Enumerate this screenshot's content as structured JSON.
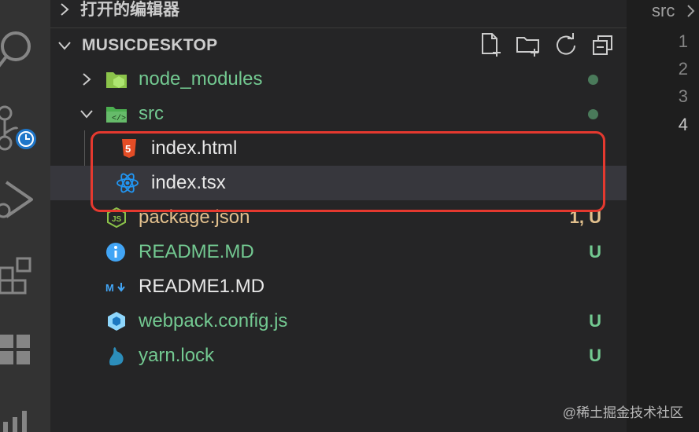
{
  "activity_bar": {
    "icons": [
      "search-icon",
      "source-control-icon",
      "clock-badge-icon",
      "run-debug-icon",
      "extensions-icon",
      "grid-icon",
      "chart-icon"
    ]
  },
  "explorer": {
    "open_editors_label": "打开的编辑器",
    "project_name": "MUSICDESKTOP",
    "toolbar_icons": [
      "new-file-icon",
      "new-folder-icon",
      "refresh-icon",
      "collapse-all-icon"
    ],
    "items": [
      {
        "name": "node_modules",
        "kind": "folder",
        "color": "#73c991",
        "decoration": "dot"
      },
      {
        "name": "src",
        "kind": "folder",
        "color": "#73c991",
        "decoration": "dot"
      },
      {
        "name": "index.html",
        "kind": "file",
        "color": "#e8e8e8",
        "decoration": ""
      },
      {
        "name": "index.tsx",
        "kind": "file",
        "color": "#e8e8e8",
        "decoration": ""
      },
      {
        "name": "package.json",
        "kind": "file",
        "color": "#e2c08d",
        "decoration": "1, U"
      },
      {
        "name": "README.MD",
        "kind": "file",
        "color": "#73c991",
        "decoration": "U"
      },
      {
        "name": "README1.MD",
        "kind": "file",
        "color": "#e8e8e8",
        "decoration": ""
      },
      {
        "name": "webpack.config.js",
        "kind": "file",
        "color": "#73c991",
        "decoration": "U"
      },
      {
        "name": "yarn.lock",
        "kind": "file",
        "color": "#73c991",
        "decoration": "U"
      }
    ]
  },
  "editor": {
    "breadcrumb": "src",
    "line_numbers": [
      "1",
      "2",
      "3",
      "4"
    ]
  },
  "watermark": "@稀土掘金技术社区",
  "colors": {
    "highlight_border": "#e5392f",
    "added": "#73c991",
    "modified": "#e2c08d"
  }
}
